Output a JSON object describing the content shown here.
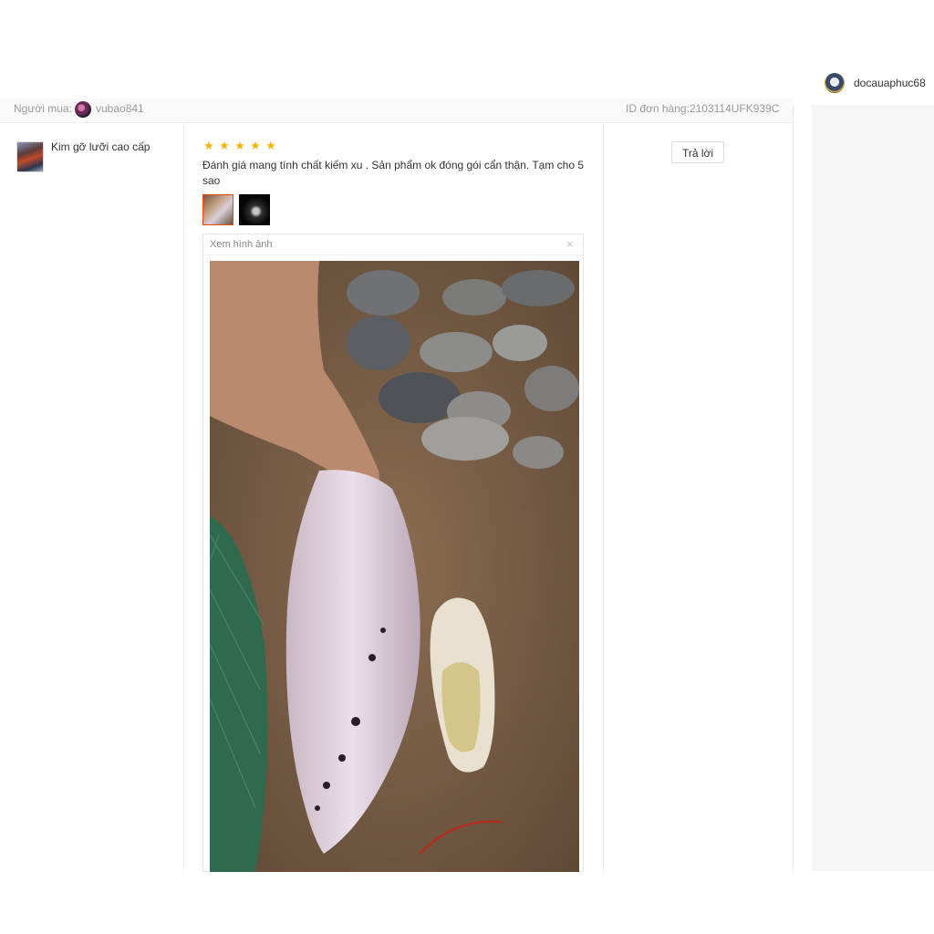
{
  "seller": {
    "name": "docauaphuc68",
    "avatar_icon": "shop-logo-avatar"
  },
  "order": {
    "buyer_label": "Người mua:",
    "buyer_name": "vubao841",
    "order_id": "ID đơn hàng:2103114UFK939C"
  },
  "product": {
    "name": "Kim gỡ lưỡi cao cấp"
  },
  "review": {
    "rating": 5,
    "stars": [
      "★",
      "★",
      "★",
      "★",
      "★"
    ],
    "text": "Đánh giá mang tính chất kiếm xu . Sản phẩm ok đóng gói cẩn thận. Tạm cho 5 sao",
    "star_color": "#f5b60a"
  },
  "viewer": {
    "title": "Xem hình ảnh",
    "close": "×"
  },
  "actions": {
    "reply_label": "Trả lời"
  }
}
